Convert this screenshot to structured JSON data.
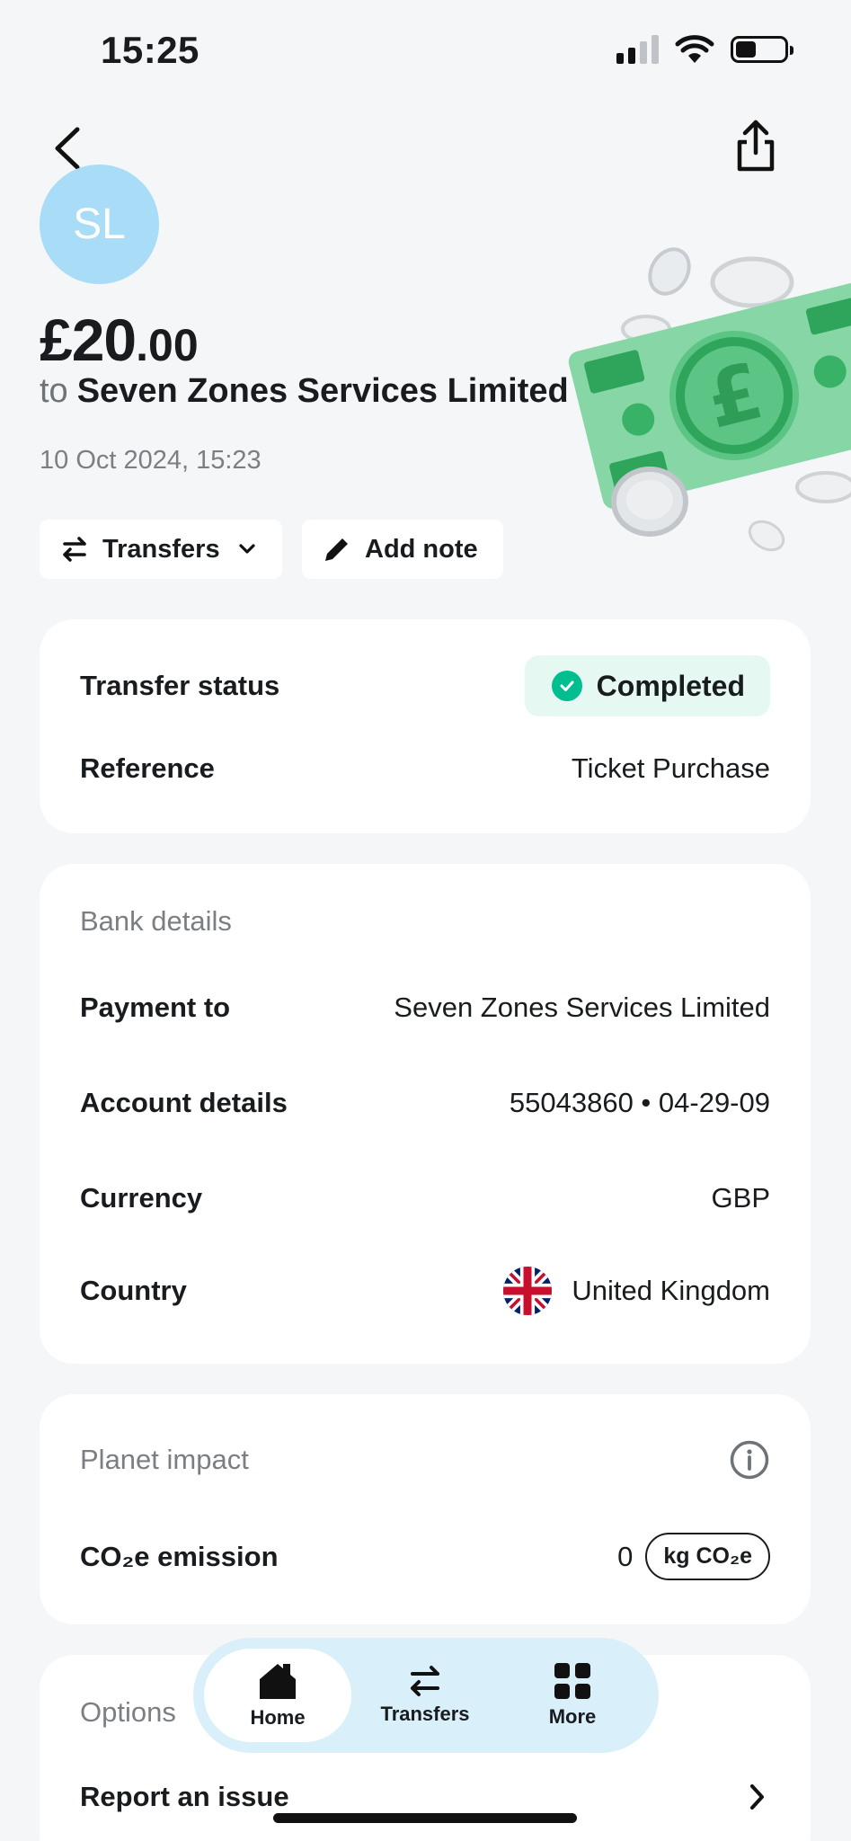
{
  "status_bar": {
    "time": "15:25"
  },
  "header": {
    "avatar_initials": "SL"
  },
  "transaction": {
    "amount_main": "£20",
    "amount_decimal": ".00",
    "to_word": "to",
    "recipient": "Seven Zones Services Limited",
    "datetime": "10 Oct 2024, 15:23"
  },
  "chips": {
    "category": "Transfers",
    "add_note": "Add note"
  },
  "status_card": {
    "status_label": "Transfer status",
    "status_value": "Completed",
    "reference_label": "Reference",
    "reference_value": "Ticket Purchase"
  },
  "bank_card": {
    "title": "Bank details",
    "payment_to_label": "Payment to",
    "payment_to_value": "Seven Zones Services Limited",
    "account_label": "Account details",
    "account_value": "55043860 • 04-29-09",
    "currency_label": "Currency",
    "currency_value": "GBP",
    "country_label": "Country",
    "country_value": "United Kingdom"
  },
  "planet_card": {
    "title": "Planet impact",
    "emission_label": "CO₂e emission",
    "emission_value": "0",
    "emission_unit": "kg CO₂e"
  },
  "options_card": {
    "title": "Options",
    "report_label": "Report an issue"
  },
  "tabbar": {
    "tabs": [
      {
        "label": "Home"
      },
      {
        "label": "Transfers"
      },
      {
        "label": "More"
      }
    ]
  },
  "colors": {
    "background": "#f5f6f7",
    "avatar": "#a9dcf7",
    "success": "#00be90",
    "success_bg": "#e5f8f1",
    "tabbar_bg": "#d9eff9"
  }
}
